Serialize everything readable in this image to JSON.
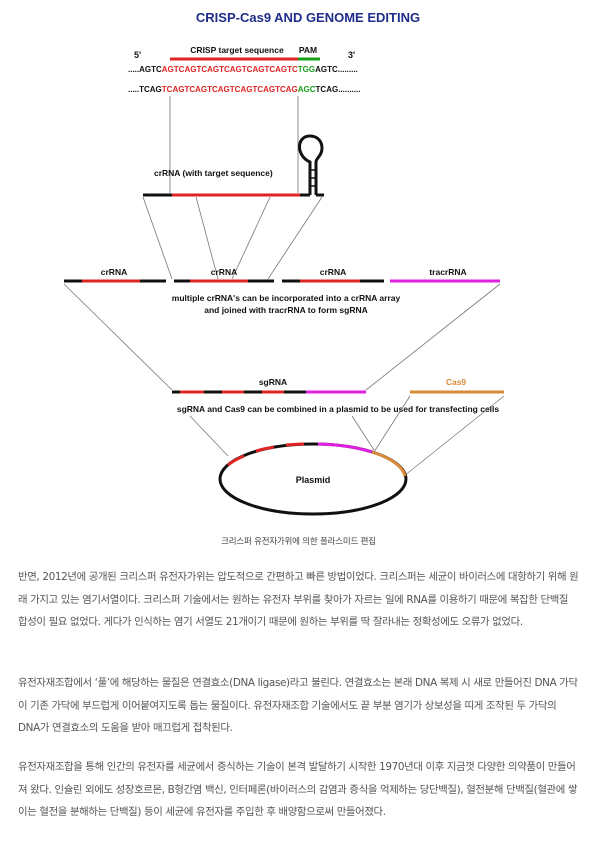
{
  "figure": {
    "title": "CRISP-Cas9 AND GENOME EDITING",
    "five_prime": "5'",
    "three_prime": "3'",
    "target_seq_label": "CRISP target sequence",
    "pam_label": "PAM",
    "top_strand": {
      "lead": ".....AGTC",
      "target": "AGTCAGTCAGTCAGTCAGTCAGTC",
      "pam": "TGG",
      "tail": "AGTC........."
    },
    "bottom_strand": {
      "lead": ".....TCAG",
      "target": "TCAGTCAGTCAGTCAGTCAGTCAG",
      "pam": "AGC",
      "tail": "TCAG.........."
    },
    "crrna_label": "crRNA (with target sequence)",
    "array_labels": [
      "crRNA",
      "crRNA",
      "crRNA",
      "tracrRNA"
    ],
    "array_caption_line1": "multiple crRNA's can be incorporated into a crRNA array",
    "array_caption_line2": "and joined with tracrRNA to form sgRNA",
    "sgrna_label": "sgRNA",
    "cas9_label": "Cas9",
    "combine_caption": "sgRNA and Cas9 can be combined in a plasmid to be used for transfecting cells",
    "plasmid_label": "Plasmid",
    "colors": {
      "title": "#1f2d8a",
      "red": "#e02424",
      "green": "#17a017",
      "magenta": "#e020e0",
      "orange": "#d98a3a",
      "black": "#111111"
    }
  },
  "caption": "크리스퍼 유전자가위에 의한 플라스미드 편집",
  "paragraphs": [
    " 반면, 2012년에 공개된 크리스퍼 유전자가위는 압도적으로 간편하고 빠른 방법이었다. 크리스퍼는 세균이 바이러스에 대항하기 위해 원래 가지고 있는 염기서열이다. 크리스퍼 기술에서는 원하는 유전자 부위를 찾아가 자르는 일에 RNA를 이용하기 때문에 복잡한 단백질 합성이 필요 없었다. 게다가 인식하는 염기 서열도 21개이기 때문에 원하는 부위를 딱 잘라내는 정확성에도 오류가 없었다.",
    " 유전자재조합에서 ‘풀’에 해당하는 물질은 연결효소(DNA ligase)라고 불린다. 연결효소는 본래 DNA 복제 시 새로 만들어진 DNA 가닥이 기존 가닥에 부드럽게 이어붙여지도록 돕는 물질이다. 유전자재조합 기술에서도 끝 부분 염기가 상보성을 띠게 조작된 두 가닥의 DNA가 연결효소의 도움을 받아 매끄럽게 접착된다.",
    " 유전자재조합을 통해 인간의 유전자를 세균에서 증식하는 기술이 본격 발달하기 시작한 1970년대 이후 지금껏 다양한 의약품이 만들어져 왔다. 인슐린 외에도 성장호르몬, B형간염 백신, 인터페론(바이러스의 감염과 증식을 억제하는 당단백질), 혈전분해 단백질(혈관에 쌓이는 혈전을 분해하는 단백질) 등이 세균에 유전자를 주입한 후 배양함으로써 만들어졌다."
  ]
}
